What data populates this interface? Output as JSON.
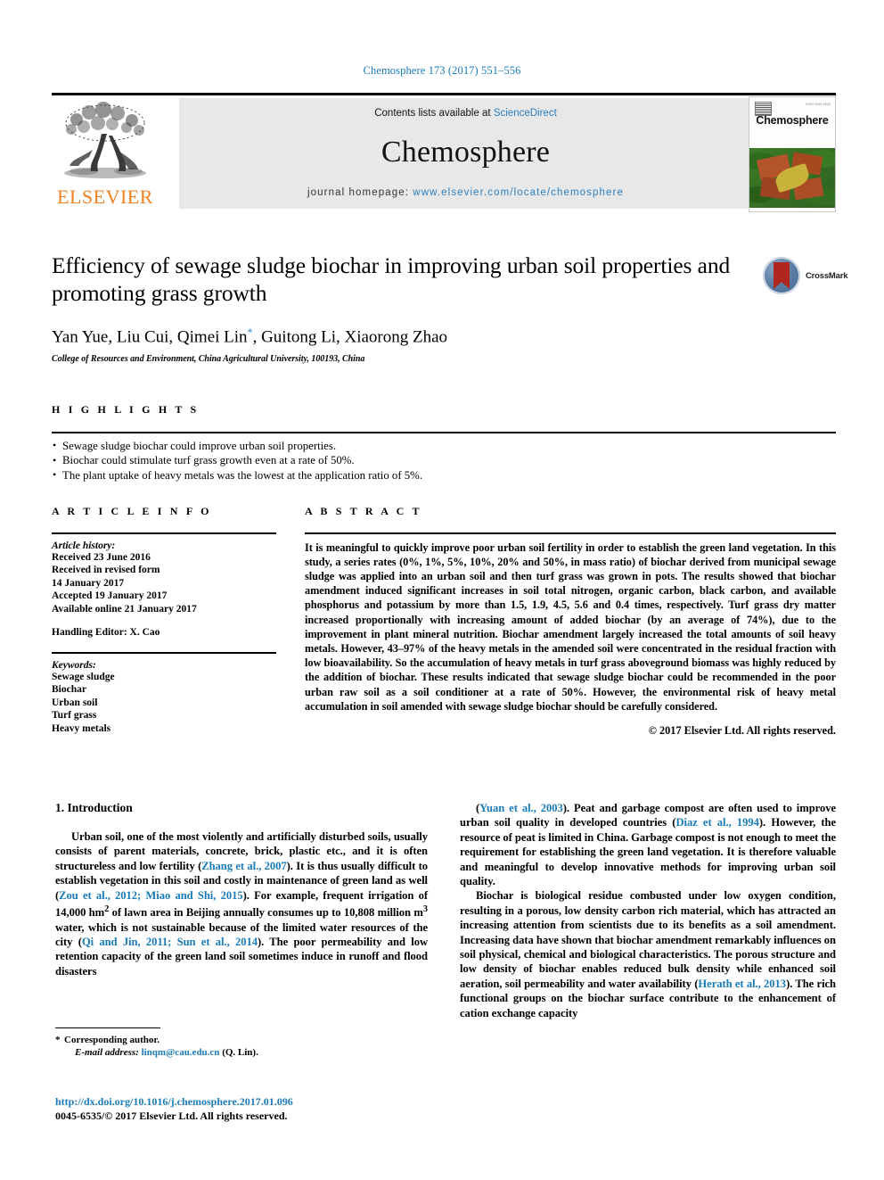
{
  "running_head": "Chemosphere 173 (2017) 551–556",
  "masthead": {
    "publisher_name": "ELSEVIER",
    "contents_prefix": "Contents lists available at ",
    "contents_link": "ScienceDirect",
    "journal_name": "Chemosphere",
    "homepage_prefix": "journal homepage: ",
    "homepage_url": "www.elsevier.com/locate/chemosphere",
    "cover": {
      "title": "Chemosphere",
      "issn_mark": "ISSN 0045-6535"
    }
  },
  "article": {
    "title": "Efficiency of sewage sludge biochar in improving urban soil properties and promoting grass growth",
    "authors": "Yan Yue, Liu Cui, Qimei Lin",
    "authors_tail": ", Guitong Li, Xiaorong Zhao",
    "corresponding_marker": "*",
    "affiliation": "College of Resources and Environment, China Agricultural University, 100193, China",
    "crossmark_label": "CrossMark"
  },
  "highlights": {
    "label": "H I G H L I G H T S",
    "items": [
      "Sewage sludge biochar could improve urban soil properties.",
      "Biochar could stimulate turf grass growth even at a rate of 50%.",
      "The plant uptake of heavy metals was the lowest at the application ratio of 5%."
    ]
  },
  "article_info": {
    "label": "A R T I C L E   I N F O",
    "history_title": "Article history:",
    "history_lines": [
      "Received 23 June 2016",
      "Received in revised form",
      "14 January 2017",
      "Accepted 19 January 2017",
      "Available online 21 January 2017"
    ],
    "handling_editor": "Handling Editor: X. Cao",
    "keywords_title": "Keywords:",
    "keywords": [
      "Sewage sludge",
      "Biochar",
      "Urban soil",
      "Turf grass",
      "Heavy metals"
    ]
  },
  "abstract": {
    "label": "A B S T R A C T",
    "text": "It is meaningful to quickly improve poor urban soil fertility in order to establish the green land vegetation. In this study, a series rates (0%, 1%, 5%, 10%, 20% and 50%, in mass ratio) of biochar derived from municipal sewage sludge was applied into an urban soil and then turf grass was grown in pots. The results showed that biochar amendment induced significant increases in soil total nitrogen, organic carbon, black carbon, and available phosphorus and potassium by more than 1.5, 1.9, 4.5, 5.6 and 0.4 times, respectively. Turf grass dry matter increased proportionally with increasing amount of added biochar (by an average of 74%), due to the improvement in plant mineral nutrition. Biochar amendment largely increased the total amounts of soil heavy metals. However, 43–97% of the heavy metals in the amended soil were concentrated in the residual fraction with low bioavailability. So the accumulation of heavy metals in turf grass aboveground biomass was highly reduced by the addition of biochar. These results indicated that sewage sludge biochar could be recommended in the poor urban raw soil as a soil conditioner at a rate of 50%. However, the environmental risk of heavy metal accumulation in soil amended with sewage sludge biochar should be carefully considered.",
    "copyright": "© 2017 Elsevier Ltd. All rights reserved."
  },
  "introduction": {
    "heading": "1. Introduction",
    "left_paragraph_html": "Urban soil, one of the most violently and artificially disturbed soils, usually consists of parent materials, concrete, brick, plastic etc., and it is often structureless and low fertility (<span class=\"cite\">Zhang et al., 2007</span>). It is thus usually difficult to establish vegetation in this soil and costly in maintenance of green land as well (<span class=\"cite\">Zou et al., 2012; Miao and Shi, 2015</span>). For example, frequent irrigation of 14,000 hm<sup>2</sup> of lawn area in Beijing annually consumes up to 10,808 million m<sup>3</sup> water, which is not sustainable because of the limited water resources of the city (<span class=\"cite\">Qi and Jin, 2011; Sun et al., 2014</span>). The poor permeability and low retention capacity of the green land soil sometimes induce in runoff and flood disasters",
    "right_paragraph1_html": "(<span class=\"cite\">Yuan et al., 2003</span>). Peat and garbage compost are often used to improve urban soil quality in developed countries (<span class=\"cite\">Diaz et al., 1994</span>). However, the resource of peat is limited in China. Garbage compost is not enough to meet the requirement for establishing the green land vegetation. It is therefore valuable and meaningful to develop innovative methods for improving urban soil quality.",
    "right_paragraph2_html": "Biochar is biological residue combusted under low oxygen condition, resulting in a porous, low density carbon rich material, which has attracted an increasing attention from scientists due to its benefits as a soil amendment. Increasing data have shown that biochar amendment remarkably influences on soil physical, chemical and biological characteristics. The porous structure and low density of biochar enables reduced bulk density while enhanced soil aeration, soil permeability and water availability (<span class=\"cite\">Herath et al., 2013</span>). The rich functional groups on the biochar surface contribute to the enhancement of cation exchange capacity"
  },
  "footnote": {
    "star": "*",
    "corresponding": "Corresponding author.",
    "email_label": "E-mail address:",
    "email": "linqm@cau.edu.cn",
    "email_owner": "(Q. Lin).",
    "doi": "http://dx.doi.org/10.1016/j.chemosphere.2017.01.096",
    "issn_copyright": "0045-6535/© 2017 Elsevier Ltd. All rights reserved."
  }
}
